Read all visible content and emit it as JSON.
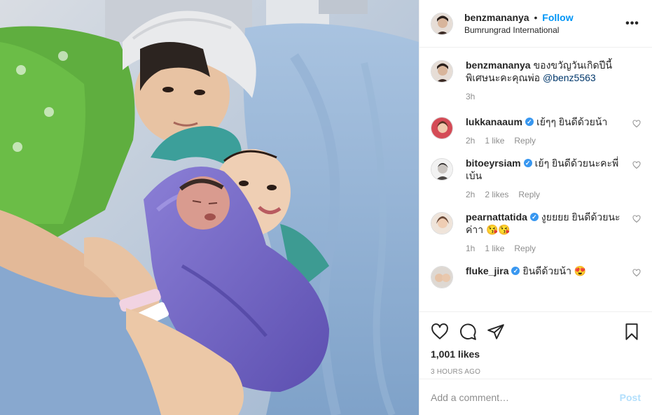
{
  "post": {
    "photo_alt": "Photo by benzmananya",
    "author": {
      "username": "benzmananya",
      "separator": "•",
      "follow_label": "Follow",
      "location": "Bumrungrad International",
      "avatar_icon": "profile-avatar"
    },
    "more_icon": "more-options-icon",
    "caption": {
      "username": "benzmananya",
      "text": "ของขวัญวันเกิดปีนี้พิเศษนะคะคุณพ่อ",
      "mention": "@benz5563",
      "time": "3h"
    },
    "comments": [
      {
        "username": "lukkanaaum",
        "verified": true,
        "text": "เย้ๆๆ ยินดีด้วยน้า",
        "time": "2h",
        "likes": "1 like",
        "reply": "Reply"
      },
      {
        "username": "bitoeyrsiam",
        "verified": true,
        "text": "เย้ๆ ยินดีด้วยนะคะพี่เบ้น",
        "time": "2h",
        "likes": "2 likes",
        "reply": "Reply"
      },
      {
        "username": "pearnattatida",
        "verified": true,
        "text": "งูยยยย ยินดีด้วยนะค่าา 😘😘",
        "time": "1h",
        "likes": "1 like",
        "reply": "Reply"
      },
      {
        "username": "fluke_jira",
        "verified": true,
        "text": "ยินดีด้วยน้า 😍",
        "time": "",
        "likes": "",
        "reply": ""
      }
    ],
    "actions": {
      "like_icon": "heart-icon",
      "comment_icon": "comment-icon",
      "share_icon": "share-icon",
      "save_icon": "bookmark-icon"
    },
    "likes": "1,001 likes",
    "time_ago": "3 HOURS AGO",
    "add_comment": {
      "placeholder": "Add a comment…",
      "post_label": "Post"
    },
    "colors": {
      "link_blue": "#0095f6",
      "post_disabled": "#b2dffc",
      "meta_gray": "#8e8e8e",
      "border": "#efefef"
    }
  }
}
